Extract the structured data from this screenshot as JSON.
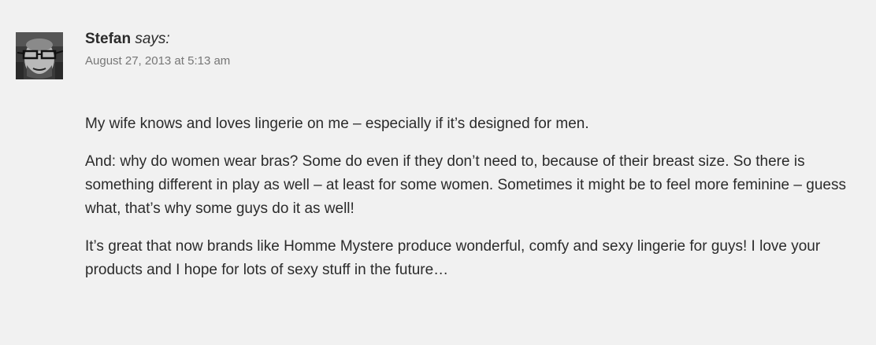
{
  "comment": {
    "author": "Stefan",
    "says": "says:",
    "date": "August 27, 2013 at 5:13 am",
    "avatar_icon": "user-avatar-photo",
    "paragraphs": [
      "My wife knows and loves lingerie on me – especially if it’s designed for men.",
      "And: why do women wear bras? Some do even if they don’t need to, because of their breast size. So there is something different in play as well – at least for some women. Sometimes it might be to feel more feminine – guess what, that’s why some guys do it as well!",
      "It’s great that now brands like Homme Mystere produce wonderful, comfy and sexy lingerie for guys! I love your products and I hope for lots of sexy stuff in the future…"
    ]
  },
  "colors": {
    "background": "#f1f1f1",
    "text": "#2b2b2b",
    "meta": "#767676"
  }
}
